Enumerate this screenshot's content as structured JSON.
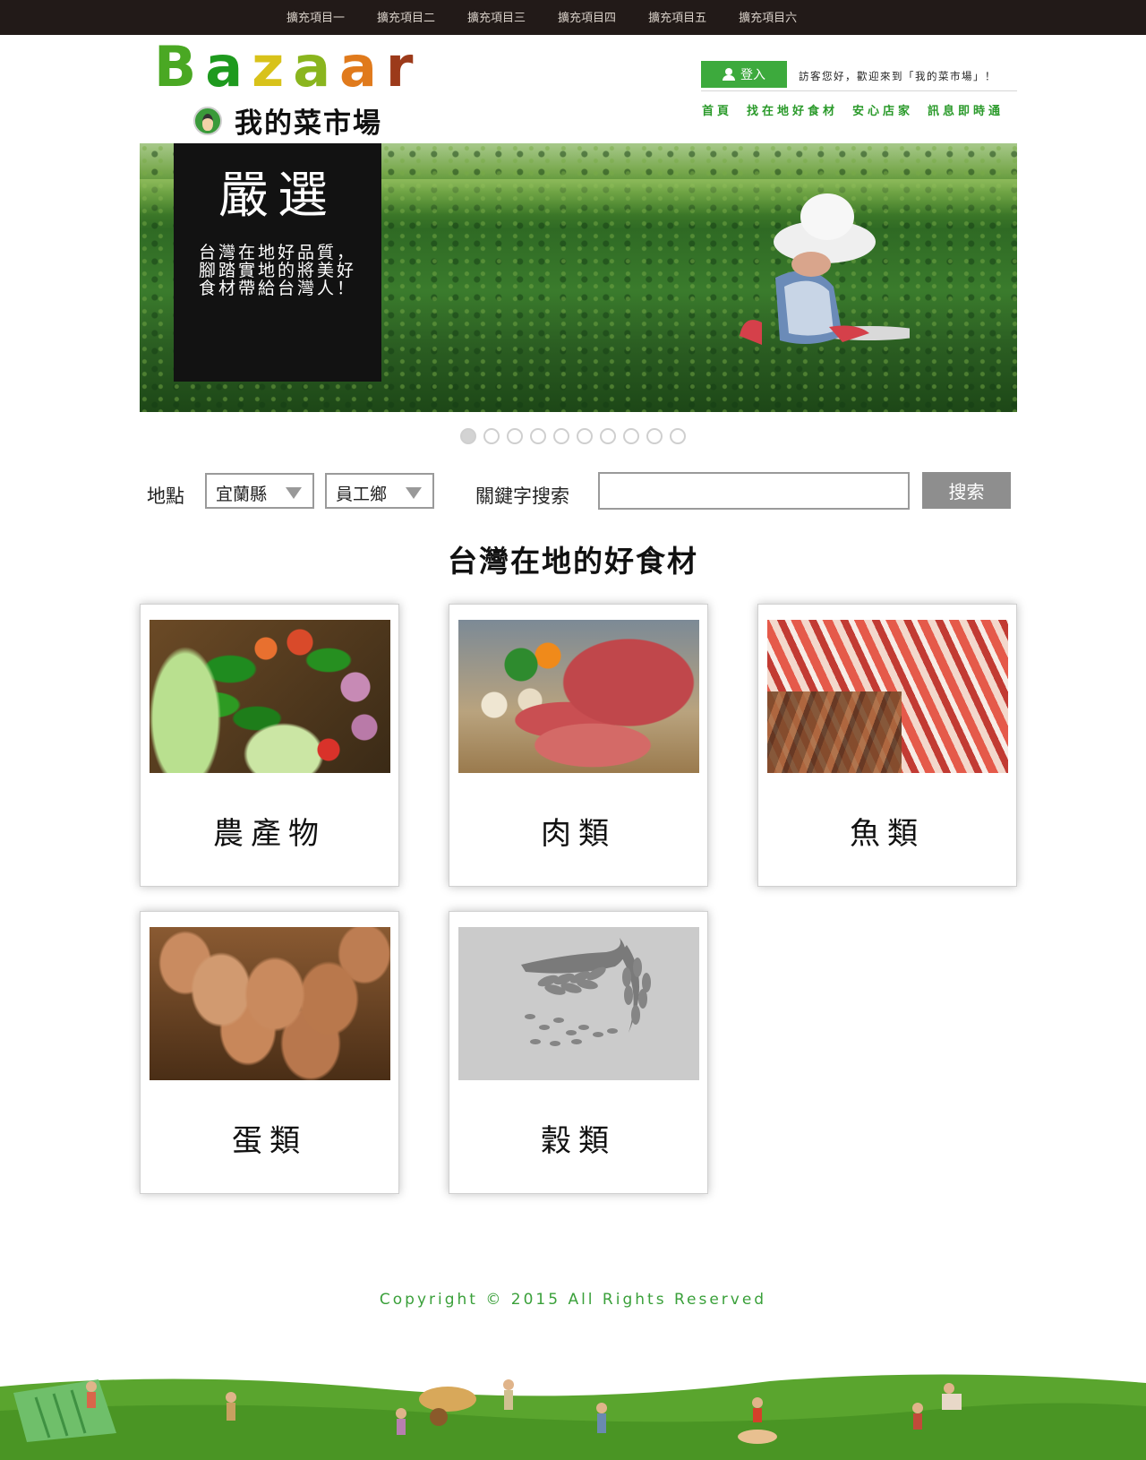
{
  "topnav": {
    "items": [
      "擴充項目一",
      "擴充項目二",
      "擴充項目三",
      "擴充項目四",
      "擴充項目五",
      "擴充項目六"
    ]
  },
  "header": {
    "logo_letters": [
      "B",
      "a",
      "z",
      "a",
      "a",
      "r"
    ],
    "logo_letter_colors": [
      "#4aa823",
      "#1e9a1e",
      "#d8c21a",
      "#8ab51e",
      "#e07a1c",
      "#9c3a1a"
    ],
    "site_title": "我的菜市場",
    "login_label": "登入",
    "welcome_text": "訪客您好，歡迎來到「我的菜市場」！",
    "nav": [
      "首頁",
      "找在地好食材",
      "安心店家",
      "訊息即時通"
    ]
  },
  "hero": {
    "heading": "嚴選",
    "text": "台灣在地好品質，腳踏實地的將美好食材帶給台灣人！",
    "slide_count": 10,
    "active_slide": 1
  },
  "search": {
    "location_label": "地點",
    "county": "宜蘭縣",
    "township": "員工鄉",
    "keyword_label": "關鍵字搜索",
    "keyword_value": "",
    "button_label": "搜索"
  },
  "section": {
    "title": "台灣在地的好食材"
  },
  "categories": [
    {
      "label": "農產物",
      "icon": "vegetables-photo"
    },
    {
      "label": "肉類",
      "icon": "meat-photo"
    },
    {
      "label": "魚類",
      "icon": "fish-photo"
    },
    {
      "label": "蛋類",
      "icon": "eggs-photo"
    },
    {
      "label": "穀類",
      "icon": "grain-icon"
    }
  ],
  "footer": {
    "copyright": "Copyright © 2015 All Rights Reserved"
  },
  "colors": {
    "topbar": "#221a18",
    "accent_green": "#3daa3d",
    "nav_green": "#2a9a2a",
    "search_button": "#8e8e8e",
    "hero_panel": "#121212"
  }
}
